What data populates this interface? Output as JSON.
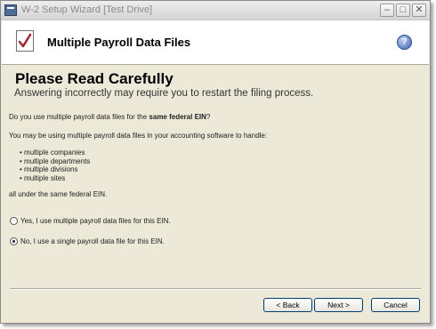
{
  "window": {
    "title": "W-2 Setup Wizard [Test Drive]",
    "min_label": "–",
    "max_label": "□",
    "close_label": "✕"
  },
  "header": {
    "title": "Multiple Payroll Data Files",
    "help_label": "?"
  },
  "content": {
    "heading": "Please Read Carefully",
    "subheading": "Answering incorrectly may require you to restart the filing process.",
    "question_prefix": "Do you use multiple payroll data files for the ",
    "question_bold": "same federal EIN",
    "question_suffix": "?",
    "intro": "You may be using multiple payroll data files in your accounting software to handle:",
    "bullets": [
      "multiple companies",
      "multiple departments",
      "multiple divisions",
      "multiple sites"
    ],
    "footer_note": "all under the same federal EIN."
  },
  "options": [
    {
      "label": "Yes, I use multiple payroll data files for this EIN.",
      "selected": false
    },
    {
      "label": "No, I use a single payroll data file for this EIN.",
      "selected": true
    }
  ],
  "buttons": {
    "back": "< Back",
    "next": "Next >",
    "cancel": "Cancel"
  }
}
